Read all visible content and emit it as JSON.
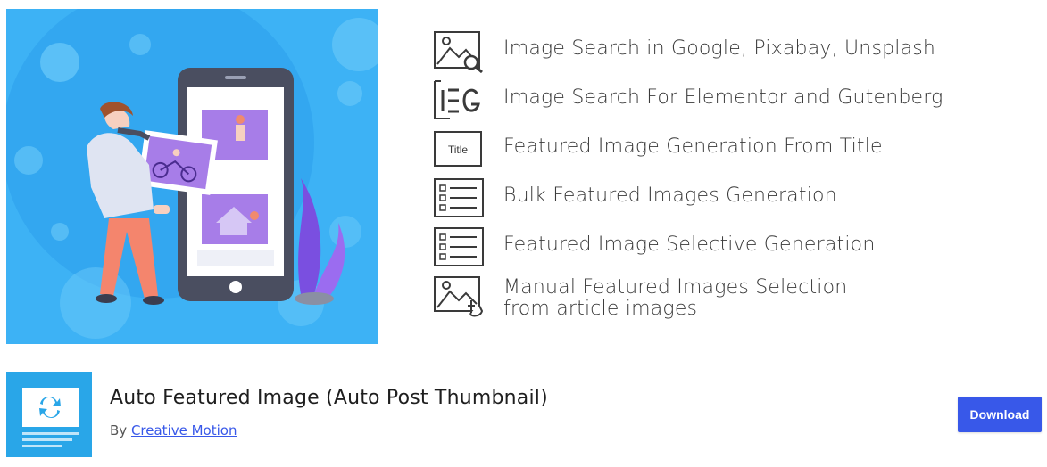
{
  "features": [
    {
      "icon": "image-search-icon",
      "lines": [
        "Image Search in Google, Pixabay, Unsplash"
      ]
    },
    {
      "icon": "elementor-gutenberg-icon",
      "lines": [
        "Image Search For Elementor and Gutenberg"
      ]
    },
    {
      "icon": "title-icon",
      "title_text": "Title",
      "lines": [
        "Featured Image Generation From Title"
      ]
    },
    {
      "icon": "checklist-icon",
      "lines": [
        "Bulk Featured Images Generation"
      ]
    },
    {
      "icon": "checklist-icon",
      "lines": [
        "Featured Image Selective Generation"
      ]
    },
    {
      "icon": "image-click-icon",
      "lines": [
        "Manual Featured Images Selection",
        "from article images"
      ]
    }
  ],
  "plugin": {
    "title": "Auto Featured Image (Auto Post Thumbnail)",
    "by_prefix": "By",
    "author": "Creative Motion",
    "download_label": "Download"
  },
  "colors": {
    "hero_bg": "#3db2f5",
    "icon_bg": "#29a6e8",
    "button": "#3858e9",
    "link": "#3858e9"
  }
}
